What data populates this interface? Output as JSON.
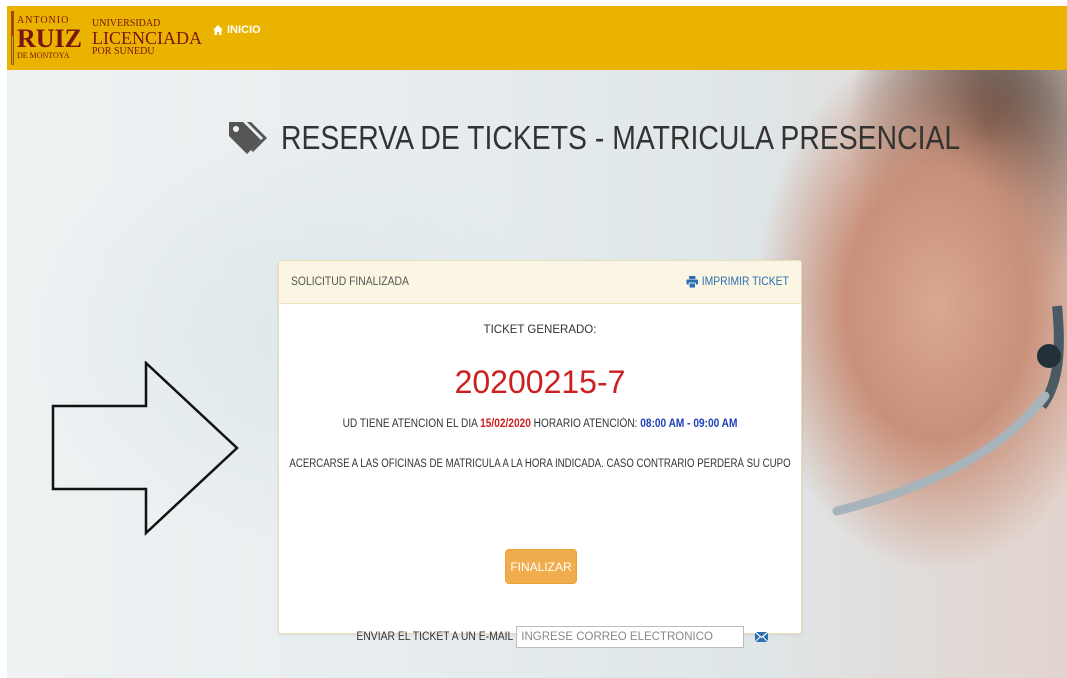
{
  "header": {
    "logo": {
      "antonio": "ANTONIO",
      "ruiz": "RUIZ",
      "montoya": "DE MONTOYA",
      "universidad": "UNIVERSIDAD",
      "licenciada": "LICENCIADA",
      "sunedu": "POR SUNEDU"
    },
    "nav_home_label": "INICIO",
    "bar_color": "#eab300"
  },
  "page": {
    "title": "RESERVA DE TICKETS - MATRICULA PRESENCIAL",
    "title_icon": "tags-icon"
  },
  "panel": {
    "heading": "SOLICITUD FINALIZADA",
    "print_label": "IMPRIMIR TICKET",
    "ticket_label": "TICKET GENERADO:",
    "ticket_number": "20200215-7",
    "attention_prefix": "UD TIENE ATENCION EL DIA",
    "attention_date": "15/02/2020",
    "schedule_label": "HORARIO ATENCIÓN:",
    "schedule_time": "08:00 AM - 09:00 AM",
    "notice": "ACERCARSE A LAS OFICINAS DE MATRICULA A LA HORA INDICADA. CASO CONTRARIO PERDERÁ SU CUPO",
    "finalize_button": "FINALIZAR",
    "email_label": "ENVIAR EL TICKET A UN E-MAIL",
    "email_value": "",
    "email_placeholder": "INGRESE CORREO ELECTRONICO"
  },
  "colors": {
    "accent_orange": "#f0ad4e",
    "ticket_red": "#cc1f1f",
    "time_blue": "#1f3fb5",
    "link_blue": "#2d6fb0"
  }
}
